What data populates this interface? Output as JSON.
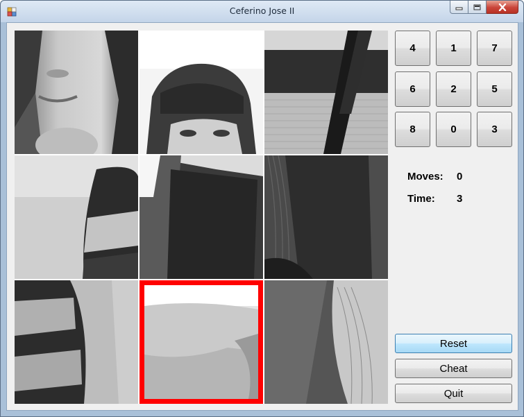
{
  "window": {
    "title": "Ceferino Jose II",
    "icons": [
      "app-icon",
      "minimize-icon",
      "maximize-icon",
      "close-icon"
    ]
  },
  "puzzle": {
    "tiles": [
      {
        "name": "tile-face-smile",
        "selected": false
      },
      {
        "name": "tile-face-eyes",
        "selected": false
      },
      {
        "name": "tile-sweater-strap",
        "selected": false
      },
      {
        "name": "tile-sweater-sleeve",
        "selected": false
      },
      {
        "name": "tile-book",
        "selected": false
      },
      {
        "name": "tile-hair-dark",
        "selected": false
      },
      {
        "name": "tile-sweater-side",
        "selected": false
      },
      {
        "name": "tile-blank",
        "selected": true
      },
      {
        "name": "tile-hair-light",
        "selected": false
      }
    ],
    "highlight_color": "#ff0000"
  },
  "order_buttons": [
    "4",
    "1",
    "7",
    "6",
    "2",
    "5",
    "8",
    "0",
    "3"
  ],
  "stats": {
    "moves_label": "Moves:",
    "moves_value": "0",
    "time_label": "Time:",
    "time_value": "3"
  },
  "actions": {
    "reset_label": "Reset",
    "cheat_label": "Cheat",
    "quit_label": "Quit"
  }
}
